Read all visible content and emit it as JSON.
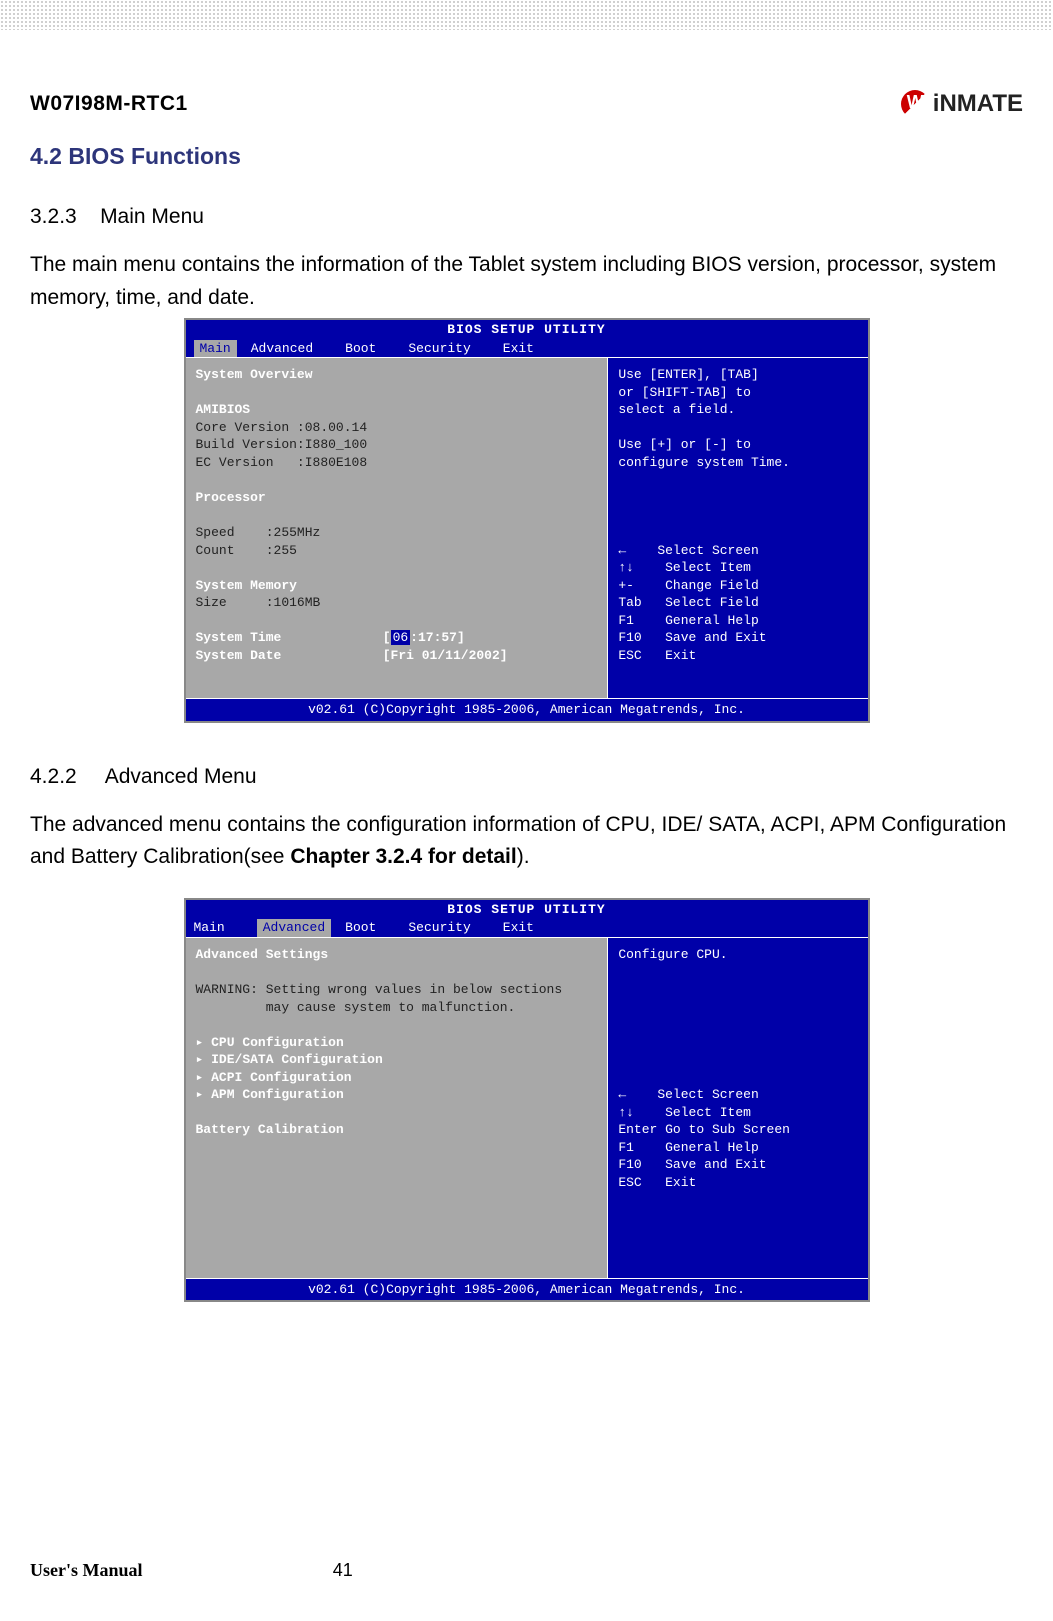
{
  "header": {
    "model": "W07I98M-RTC1",
    "brand": "iNMATE"
  },
  "section": {
    "h1": "4.2 BIOS Functions",
    "s1num": "3.2.3",
    "s1title": "Main Menu",
    "p1": "The main menu contains the information of the Tablet system including BIOS version, processor, system memory, time, and date.",
    "s2num": "4.2.2",
    "s2title": "Advanced Menu",
    "p2a": "The advanced menu contains the configuration information of CPU, IDE/ SATA, ACPI, APM Configuration and Battery Calibration(see ",
    "p2b": "Chapter 3.2.4 for detail",
    "p2c": ")."
  },
  "bios1": {
    "title": "BIOS SETUP UTILITY",
    "tabs": {
      "t1": "Main",
      "t2": "Advanced",
      "t3": "Boot",
      "t4": "Security",
      "t5": "Exit"
    },
    "overview": "System Overview",
    "ami": "AMIBIOS",
    "core": "Core Version :08.00.14",
    "build": "Build Version:I880_100",
    "ec": "EC Version   :I880E108",
    "proc": "Processor",
    "speed": "Speed    :255MHz",
    "count": "Count    :255",
    "mem": "System Memory",
    "size": "Size     :1016MB",
    "st": "System Time",
    "sd": "System Date",
    "stv_a": "[",
    "stv_hh": "06",
    "stv_b": ":17:57]",
    "sdv": "[Fri 01/11/2002]",
    "help1": "Use [ENTER], [TAB]\nor [SHIFT-TAB] to\nselect a field.",
    "help2": "Use [+] or [-] to\nconfigure system Time.",
    "nav": "←    Select Screen\n↑↓    Select Item\n+-    Change Field\nTab   Select Field\nF1    General Help\nF10   Save and Exit\nESC   Exit",
    "foot": "v02.61 (C)Copyright 1985-2006, American Megatrends, Inc."
  },
  "bios2": {
    "title": "BIOS SETUP UTILITY",
    "tabs": {
      "t1": "Main",
      "t2": "Advanced",
      "t3": "Boot",
      "t4": "Security",
      "t5": "Exit"
    },
    "adv": "Advanced Settings",
    "warn": "WARNING: Setting wrong values in below sections\n         may cause system to malfunction.",
    "i1": "▸ CPU Configuration",
    "i2": "▸ IDE/SATA Configuration",
    "i3": "▸ ACPI Configuration",
    "i4": "▸ APM Configuration",
    "bc": "Battery Calibration",
    "help": "Configure CPU.",
    "nav": "←    Select Screen\n↑↓    Select Item\nEnter Go to Sub Screen\nF1    General Help\nF10   Save and Exit\nESC   Exit",
    "foot": "v02.61 (C)Copyright 1985-2006, American Megatrends, Inc."
  },
  "footer": {
    "um": "User's Manual",
    "page": "41"
  }
}
